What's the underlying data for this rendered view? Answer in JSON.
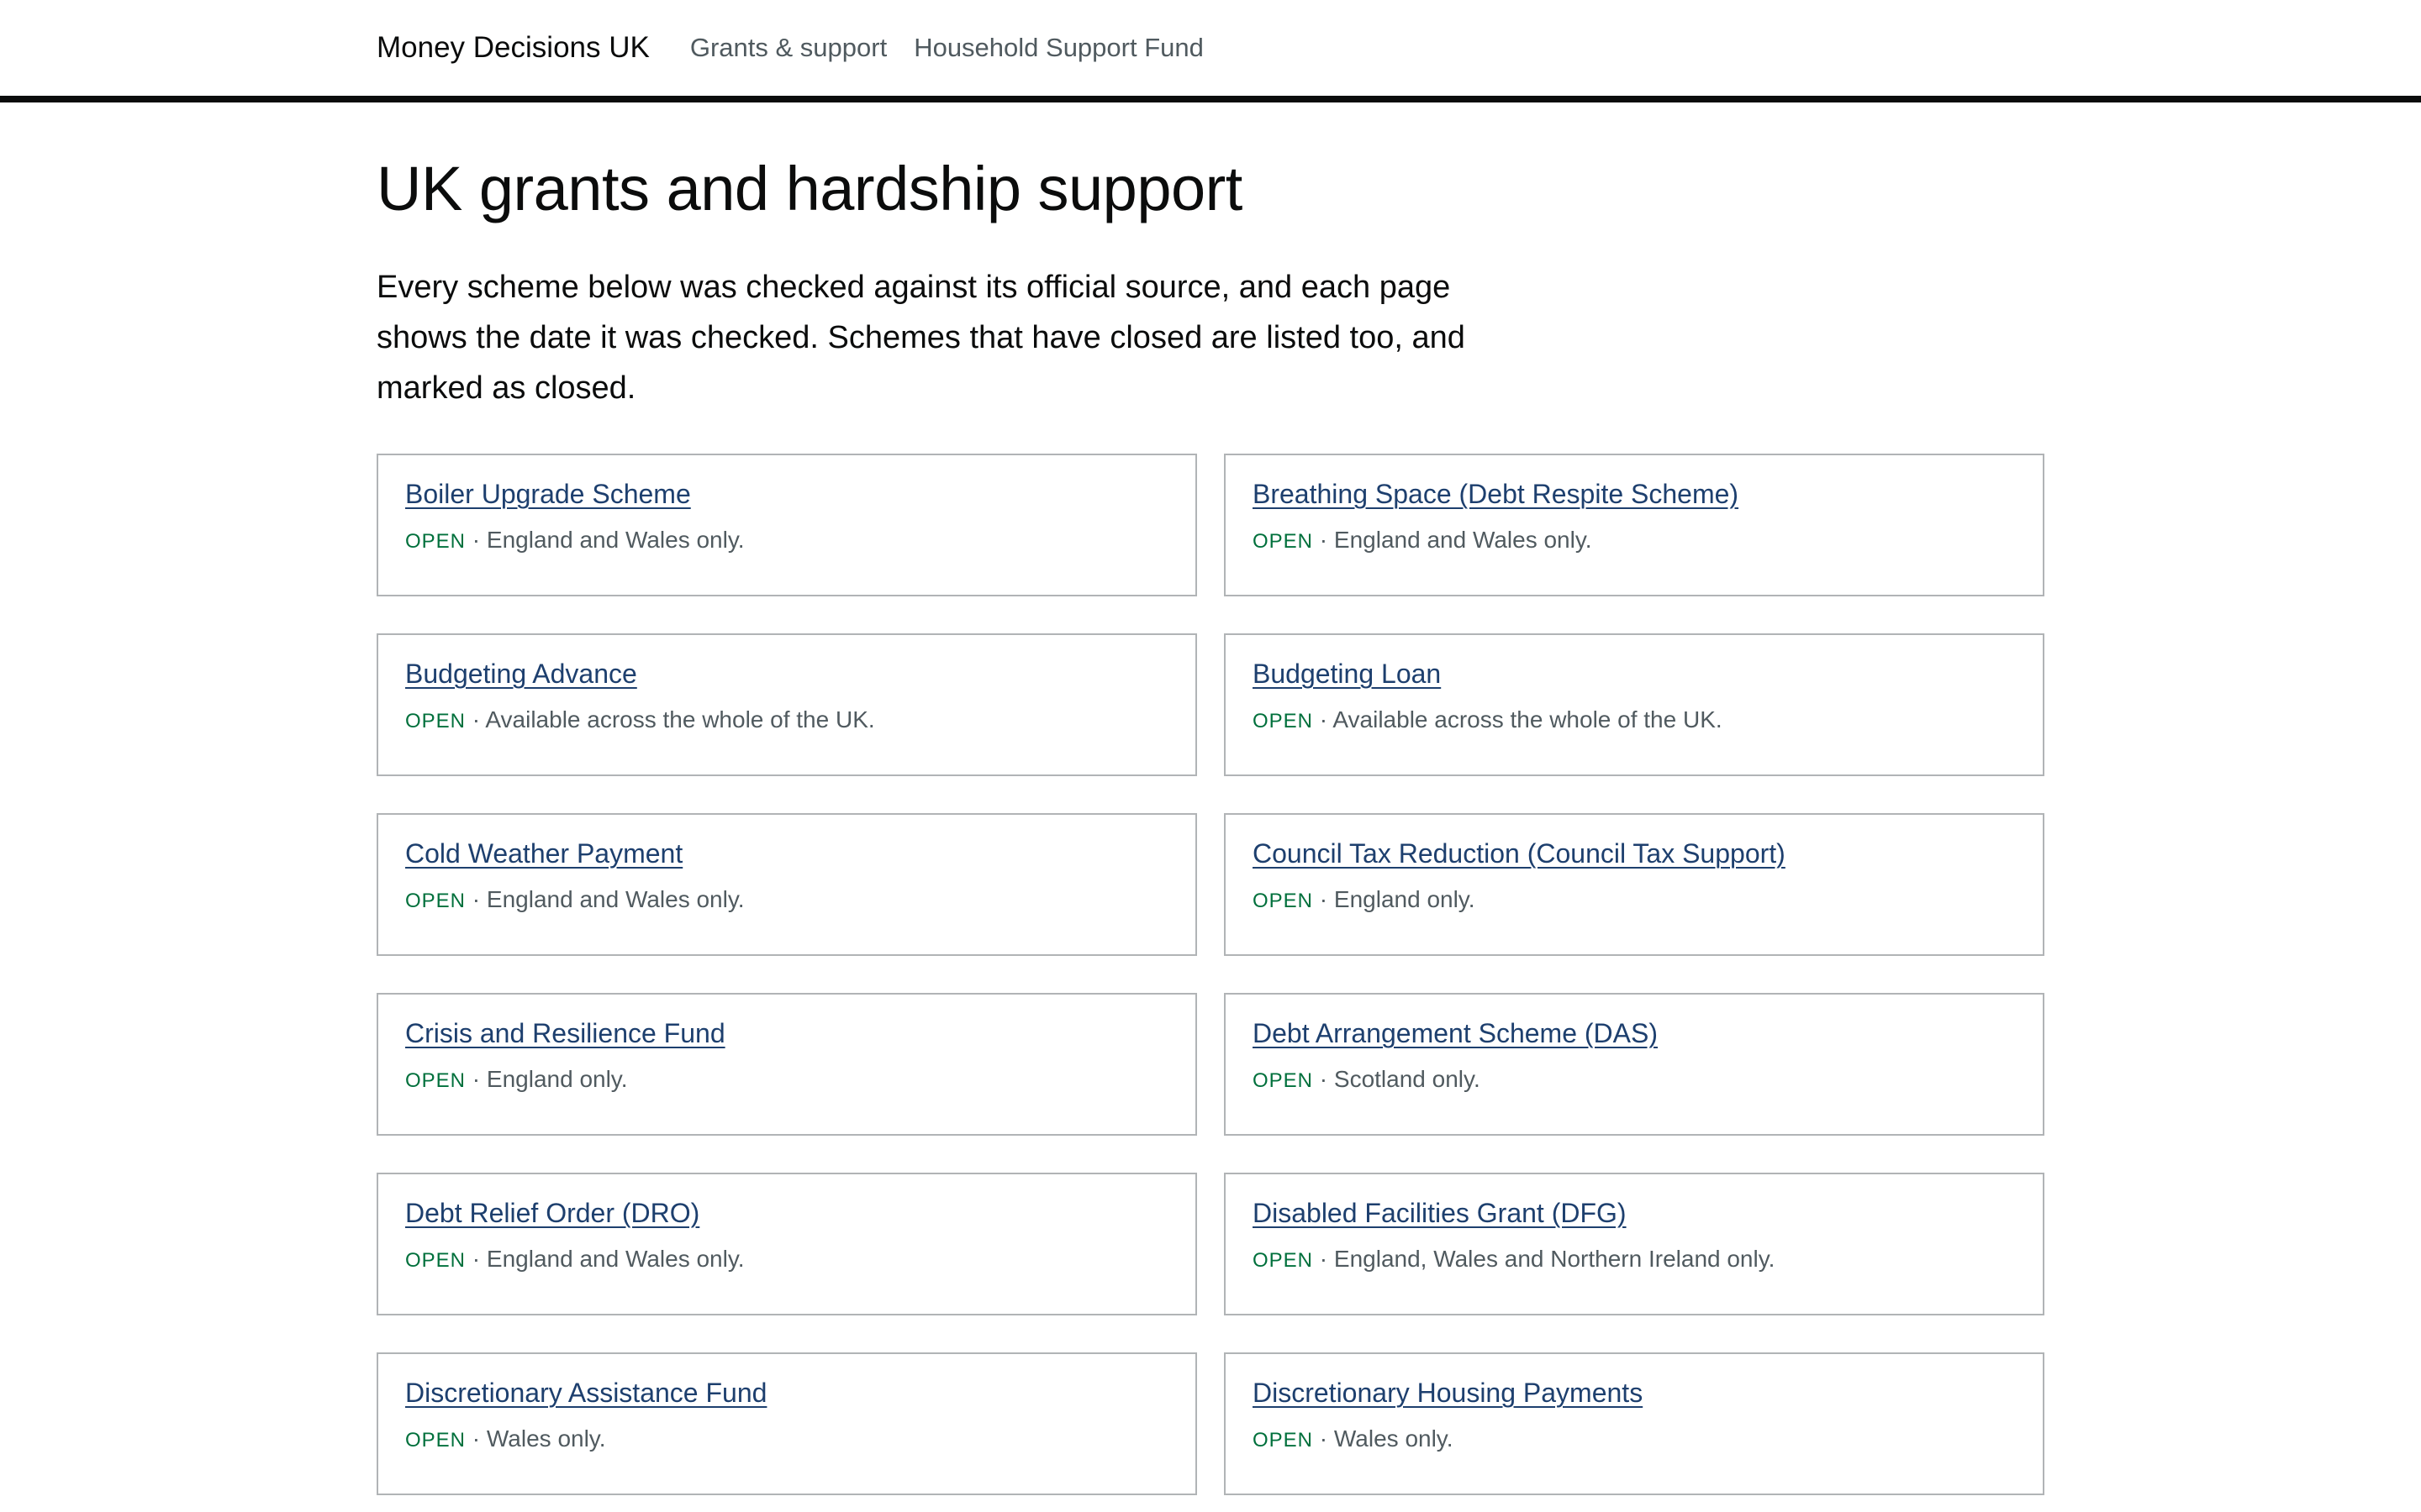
{
  "header": {
    "site_name": "Money Decisions UK",
    "breadcrumbs": [
      {
        "label": "Grants & support"
      },
      {
        "label": "Household Support Fund"
      }
    ]
  },
  "main": {
    "title": "UK grants and hardship support",
    "lede": "Every scheme below was checked against its official source, and each page shows the date it was checked. Schemes that have closed are listed too, and marked as closed.",
    "separator": "·",
    "schemes": [
      {
        "name": "Boiler Upgrade Scheme",
        "status": "OPEN",
        "coverage": "England and Wales only."
      },
      {
        "name": "Breathing Space (Debt Respite Scheme)",
        "status": "OPEN",
        "coverage": "England and Wales only."
      },
      {
        "name": "Budgeting Advance",
        "status": "OPEN",
        "coverage": "Available across the whole of the UK."
      },
      {
        "name": "Budgeting Loan",
        "status": "OPEN",
        "coverage": "Available across the whole of the UK."
      },
      {
        "name": "Cold Weather Payment",
        "status": "OPEN",
        "coverage": "England and Wales only."
      },
      {
        "name": "Council Tax Reduction (Council Tax Support)",
        "status": "OPEN",
        "coverage": "England only."
      },
      {
        "name": "Crisis and Resilience Fund",
        "status": "OPEN",
        "coverage": "England only."
      },
      {
        "name": "Debt Arrangement Scheme (DAS)",
        "status": "OPEN",
        "coverage": "Scotland only."
      },
      {
        "name": "Debt Relief Order (DRO)",
        "status": "OPEN",
        "coverage": "England and Wales only."
      },
      {
        "name": "Disabled Facilities Grant (DFG)",
        "status": "OPEN",
        "coverage": "England, Wales and Northern Ireland only."
      },
      {
        "name": "Discretionary Assistance Fund",
        "status": "OPEN",
        "coverage": "Wales only."
      },
      {
        "name": "Discretionary Housing Payments",
        "status": "OPEN",
        "coverage": "Wales only."
      }
    ]
  },
  "colors": {
    "link": "#1d3f6e",
    "status_open": "#00703c",
    "muted_text": "#505a5f",
    "border": "#b1b4b6",
    "header_rule": "#0b0c0c"
  }
}
